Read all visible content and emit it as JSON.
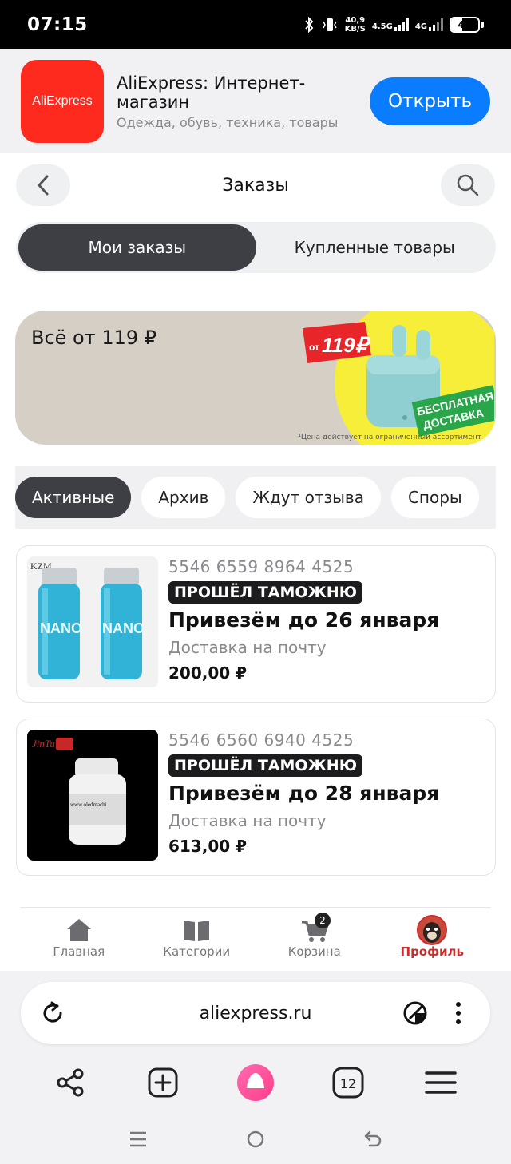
{
  "status": {
    "time": "07:15",
    "speed_value": "40,9",
    "speed_unit": "KB/S",
    "net1": "4.5G",
    "net2": "4G",
    "battery": "41",
    "battery_level_percent": 41
  },
  "app_banner": {
    "logo_text": "AliExpress",
    "name": "AliExpress: Интернет-магазин",
    "desc": "Одежда, обувь, техника, товары",
    "open_label": "Открыть"
  },
  "header": {
    "title": "Заказы"
  },
  "segments": [
    {
      "label": "Мои заказы",
      "active": true
    },
    {
      "label": "Купленные товары",
      "active": false
    }
  ],
  "promo": {
    "title": "Всё от 119 ₽",
    "price_tag_prefix": "от",
    "price_tag": "119₽",
    "free_delivery_1": "БЕСПЛАТНАЯ",
    "free_delivery_2": "ДОСТАВКА",
    "note": "¹Цена действует на ограниченный ассортимент"
  },
  "filters": [
    {
      "label": "Активные",
      "active": true
    },
    {
      "label": "Архив",
      "active": false
    },
    {
      "label": "Ждут отзыва",
      "active": false
    },
    {
      "label": "Споры",
      "active": false
    }
  ],
  "orders": [
    {
      "number": "5546 6559 8964 4525",
      "badge": "ПРОШЁЛ ТАМОЖНЮ",
      "title": "Привезём до 26 января",
      "delivery": "Доставка на почту",
      "price": "200,00 ₽",
      "image_brand": "KZM",
      "image_text": "NANO"
    },
    {
      "number": "5546 6560 6940 4525",
      "badge": "ПРОШЁЛ ТАМОЖНЮ",
      "title": "Привезём до 28 января",
      "delivery": "Доставка на почту",
      "price": "613,00 ₽",
      "image_brand": "JinTu",
      "image_text": "www.oledmachi"
    }
  ],
  "bottom_nav": {
    "home": "Главная",
    "categories": "Категории",
    "cart": "Корзина",
    "cart_count": "2",
    "profile": "Профиль"
  },
  "browser": {
    "url": "aliexpress.ru",
    "tabs_count": "12"
  },
  "colors": {
    "accent_blue": "#0a7cff",
    "brand_red": "#ff2a1e",
    "profile_red": "#d02a2a",
    "dark_chip": "#3d3f44"
  }
}
